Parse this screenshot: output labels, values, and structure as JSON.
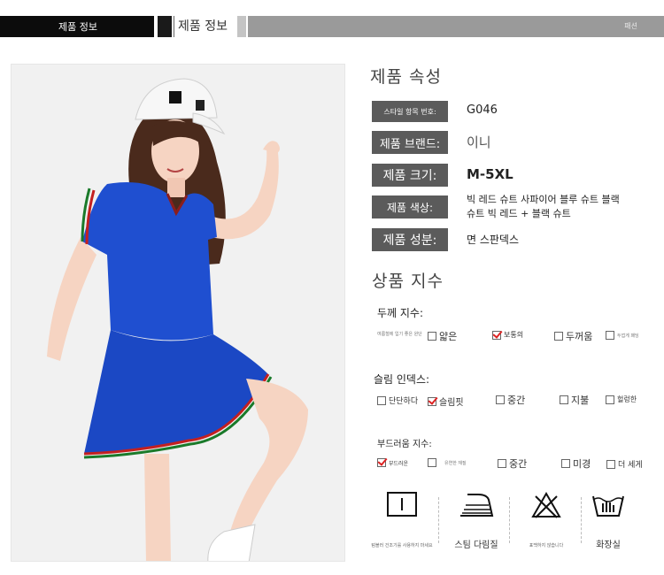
{
  "header": {
    "tab_left": "제품 정보",
    "tab_right": "제품 정보",
    "corner_text": "패션"
  },
  "attributes": {
    "title": "제품 속성",
    "rows": [
      {
        "label": "스타일 항목 번호:",
        "value": "G046"
      },
      {
        "label": "제품 브랜드:",
        "value": "이니"
      },
      {
        "label": "제품 크기:",
        "value": "M-5XL"
      },
      {
        "label": "제품 색상:",
        "value": "빅 레드 슈트 사파이어 블루 슈트 블랙 슈트 빅 레드 + 블랙 슈트"
      },
      {
        "label": "제품 성분:",
        "value": "면 스판덱스"
      }
    ]
  },
  "index": {
    "title": "상품 지수",
    "groups": [
      {
        "title": "두께 지수:",
        "options": [
          {
            "label": "여름철에 입기 좋은 원단",
            "checked": false
          },
          {
            "label": "얇은",
            "checked": false
          },
          {
            "label": "보통의",
            "checked": true
          },
          {
            "label": "두꺼움",
            "checked": false
          },
          {
            "label": "두껍게 패딩",
            "checked": false
          }
        ]
      },
      {
        "title": "슬림 인덱스:",
        "options": [
          {
            "label": "단단하다",
            "checked": false
          },
          {
            "label": "슬림핏",
            "checked": true
          },
          {
            "label": "중간",
            "checked": false
          },
          {
            "label": "지불",
            "checked": false
          },
          {
            "label": "헐렁한",
            "checked": false
          }
        ]
      },
      {
        "title": "부드러움 지수:",
        "options": [
          {
            "label": "부드러운",
            "checked": true
          },
          {
            "label": "",
            "checked": false
          },
          {
            "label": "유연한 재질",
            "checked": false
          },
          {
            "label": "중간",
            "checked": false
          },
          {
            "label": "미경",
            "checked": false
          },
          {
            "label": "더 세게",
            "checked": false
          }
        ]
      }
    ]
  },
  "care": [
    {
      "icon": "tumble-dry-icon",
      "label": "텀블러 건조기를 사용하지 마세요"
    },
    {
      "icon": "steam-iron-icon",
      "label": "스팀 다림질"
    },
    {
      "icon": "no-bleach-icon",
      "label": "표백하지 않습니다"
    },
    {
      "icon": "hand-wash-icon",
      "label": "화장실"
    }
  ],
  "colors": {
    "label_bg": "#5b5b5b",
    "dress_blue": "#1f4fd0",
    "check_red": "#dd2222"
  }
}
